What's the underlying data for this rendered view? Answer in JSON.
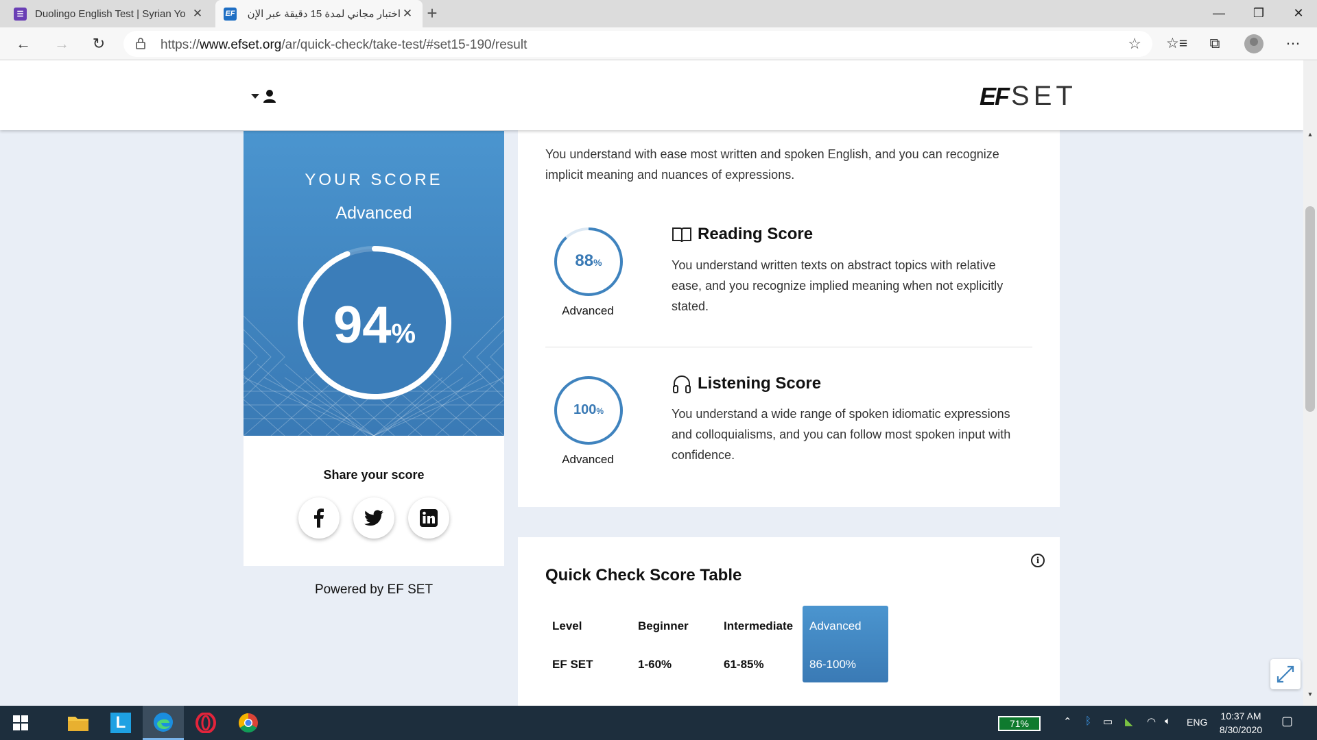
{
  "browser": {
    "tabs": [
      {
        "title": "Duolingo English Test | Syrian Yo",
        "favicon": "tasks-icon"
      },
      {
        "title": "اختبار مجاني لمدة 15 دقيقة عبر الإن",
        "favicon": "EF"
      }
    ],
    "url_prefix": "https://",
    "url_domain": "www.efset.org",
    "url_path": "/ar/quick-check/take-test/#set15-190/result"
  },
  "site": {
    "logo_ef": "EF",
    "logo_set": "SET"
  },
  "score": {
    "heading": "YOUR SCORE",
    "level": "Advanced",
    "value": "94",
    "percent_sign": "%",
    "fraction": 0.94
  },
  "share": {
    "title": "Share your score",
    "networks": [
      "facebook",
      "twitter",
      "linkedin"
    ],
    "powered_by": "Powered by EF SET"
  },
  "details": {
    "summary": "You understand with ease most written and spoken English, and you can recognize implicit meaning and nuances of expressions.",
    "reading": {
      "title": "Reading Score",
      "value": "88",
      "percent_sign": "%",
      "fraction": 0.88,
      "level": "Advanced",
      "description": "You understand written texts on abstract topics with relative ease, and you recognize implied meaning when not explicitly stated."
    },
    "listening": {
      "title": "Listening Score",
      "value": "100",
      "percent_sign": "%",
      "fraction": 1.0,
      "level": "Advanced",
      "description": "You understand a wide range of spoken idiomatic expressions and colloquialisms, and you can follow most spoken input with confidence."
    }
  },
  "score_table": {
    "title": "Quick Check Score Table",
    "headers": [
      "Level",
      "Beginner",
      "Intermediate",
      "Advanced"
    ],
    "row": [
      "EF SET",
      "1-60%",
      "61-85%",
      "86-100%"
    ],
    "highlighted": "Advanced"
  },
  "taskbar": {
    "battery": "71%",
    "language": "ENG",
    "time": "10:37 AM",
    "date": "8/30/2020"
  },
  "colors": {
    "brand_blue": "#3f83be",
    "taskbar": "#1d2e3d"
  }
}
